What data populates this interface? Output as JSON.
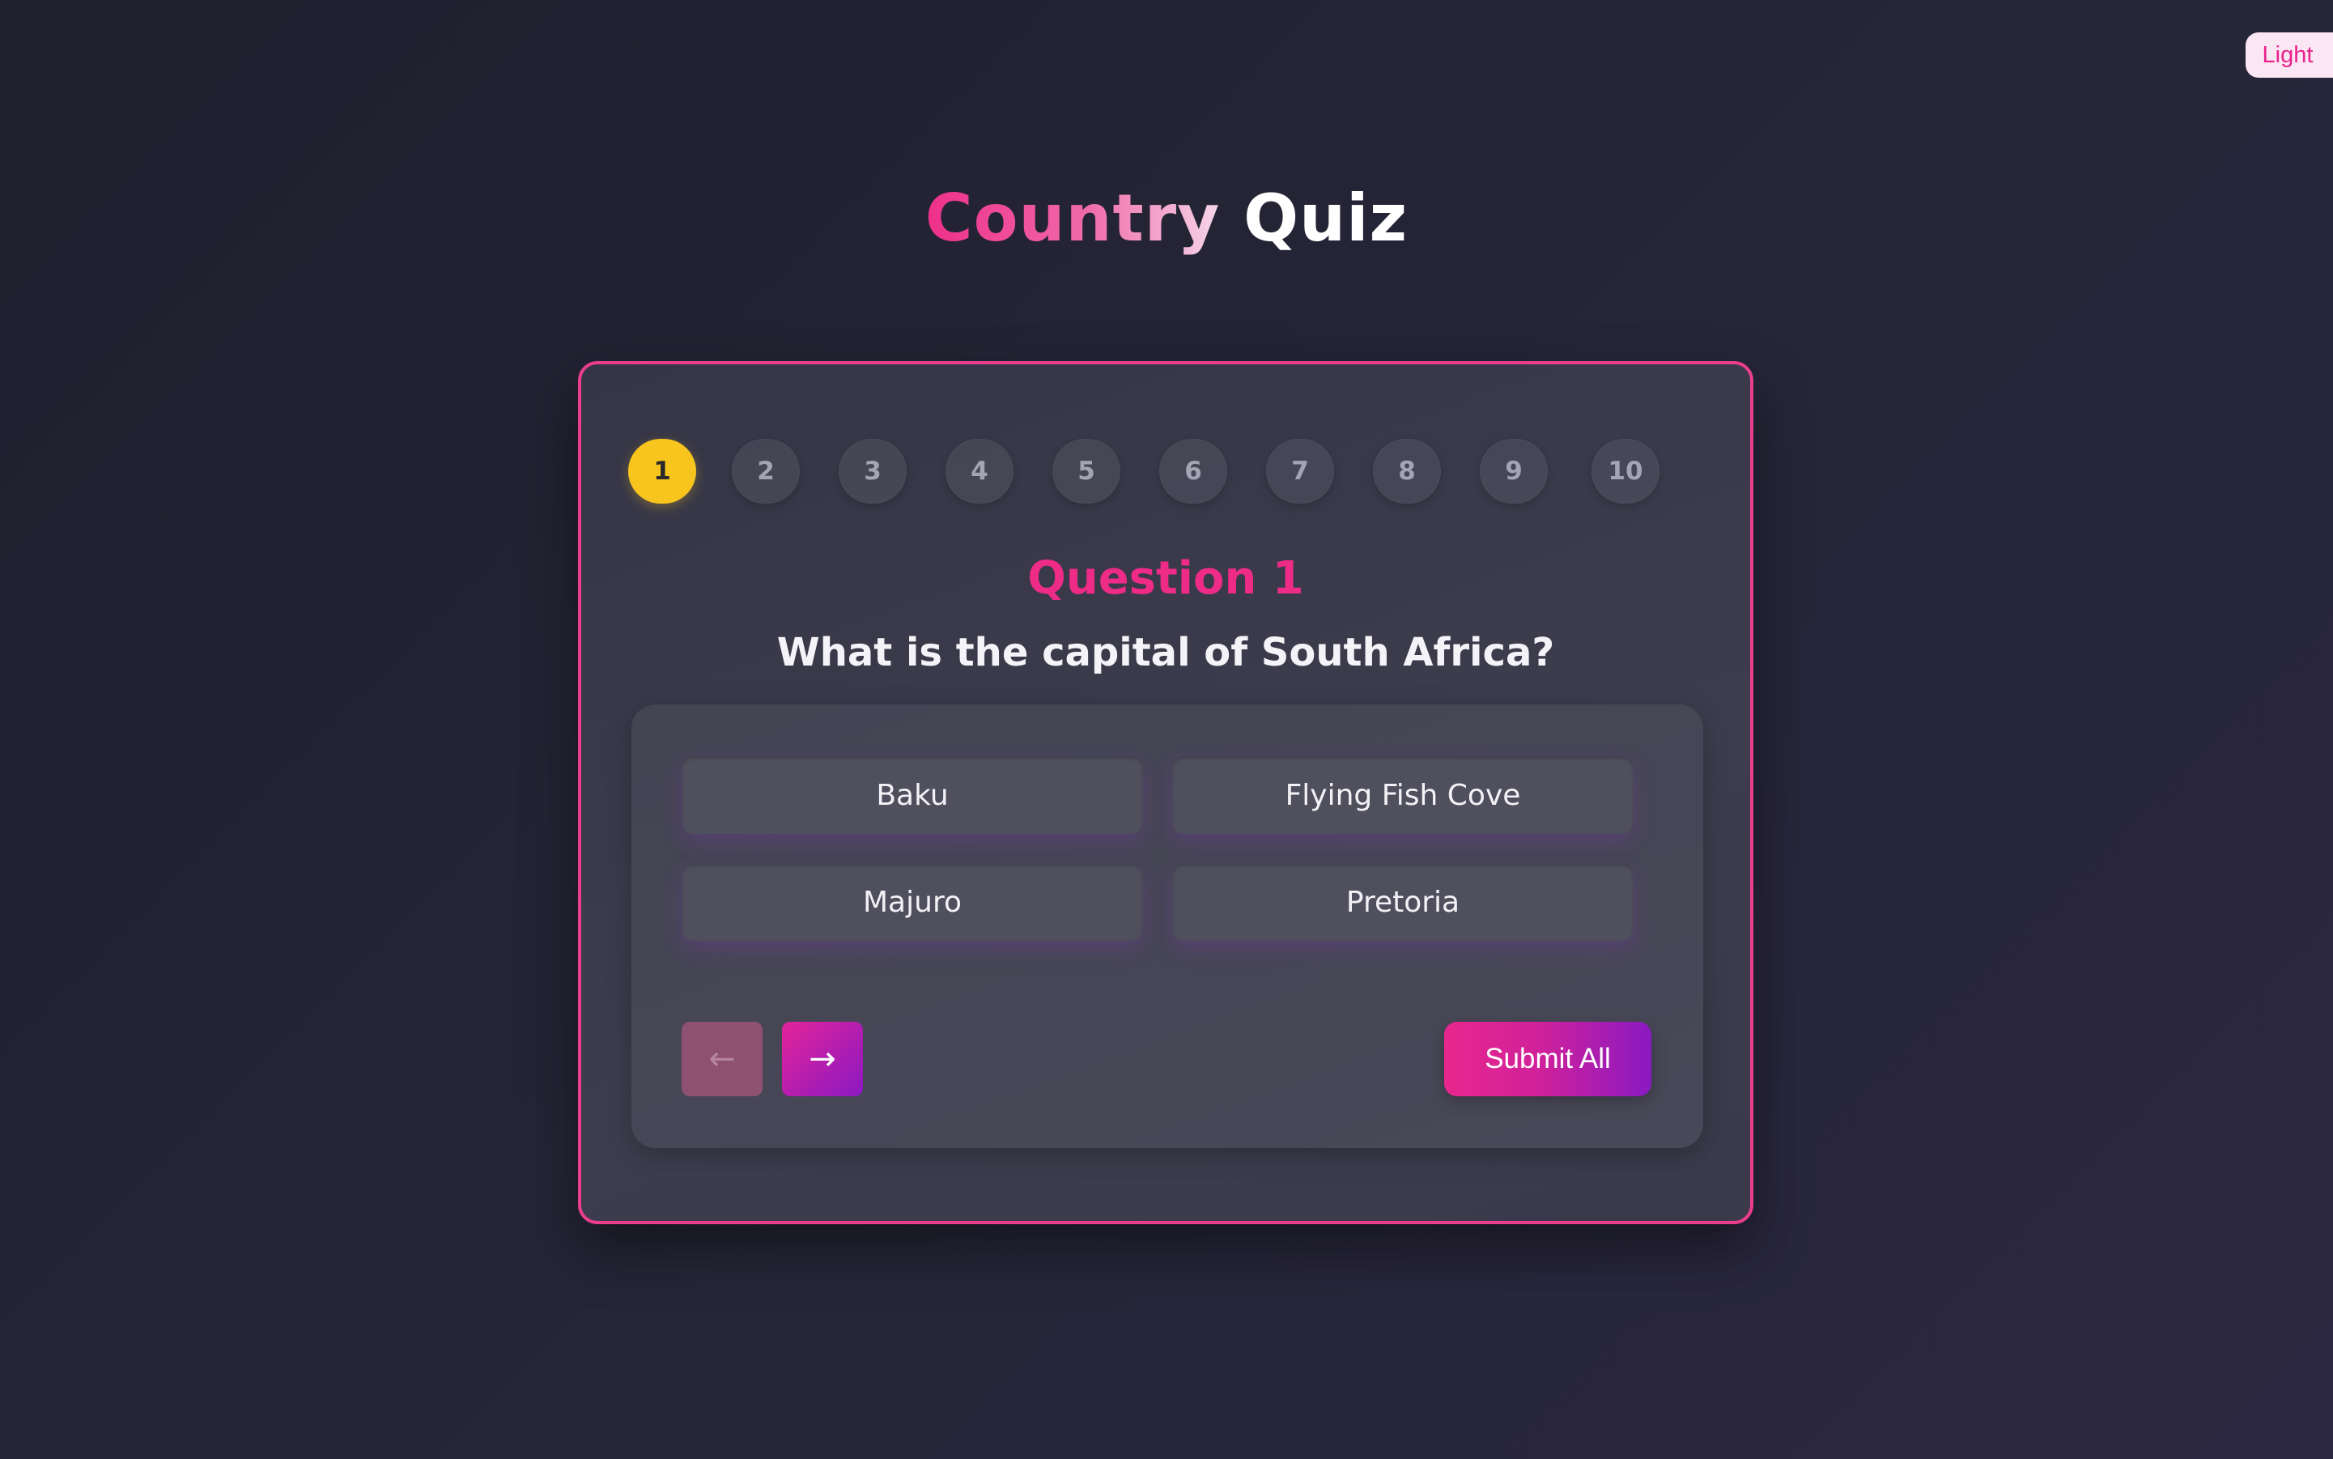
{
  "theme_toggle": {
    "label": "Light"
  },
  "header": {
    "title_accent": "Country",
    "title_rest": "Quiz"
  },
  "steps": {
    "active": 1,
    "items": [
      "1",
      "2",
      "3",
      "4",
      "5",
      "6",
      "7",
      "8",
      "9",
      "10"
    ]
  },
  "question": {
    "label": "Question 1",
    "text": "What is the capital of South Africa?"
  },
  "answers": [
    "Baku",
    "Flying Fish Cove",
    "Majuro",
    "Pretoria"
  ],
  "navigation": {
    "prev_label": "←",
    "next_label": "→",
    "submit_label": "Submit All"
  },
  "colors": {
    "accent": "#ea3d8e",
    "active_step": "#f7c51d",
    "background": "#232333"
  },
  "icons": {
    "prev": "arrow-left-icon",
    "next": "arrow-right-icon"
  }
}
